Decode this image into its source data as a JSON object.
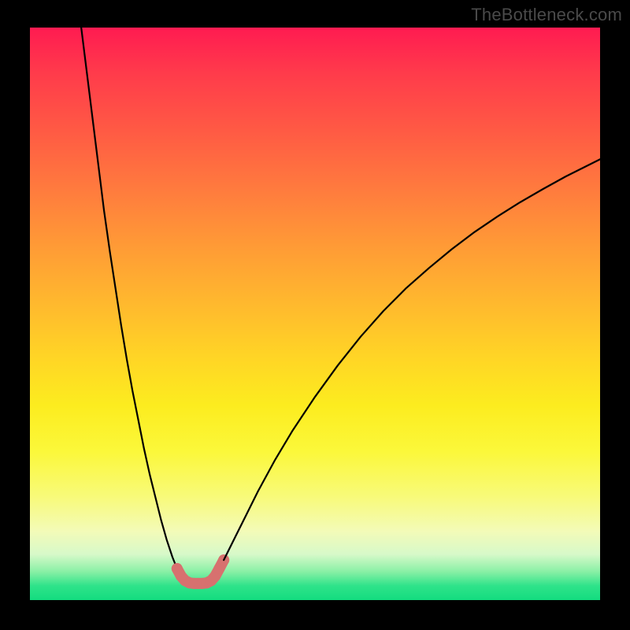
{
  "watermark": "TheBottleneck.com",
  "chart_data": {
    "type": "line",
    "title": "",
    "xlabel": "",
    "ylabel": "",
    "xlim": [
      0,
      100
    ],
    "ylim": [
      0,
      100
    ],
    "grid": false,
    "legend": false,
    "series": [
      {
        "name": "left-branch",
        "stroke": "#000000",
        "strokeWidth": 2.2,
        "x": [
          9,
          10,
          11,
          12,
          13,
          14,
          15,
          16,
          17,
          18,
          19,
          20,
          21,
          22,
          23,
          24,
          25,
          25.8
        ],
        "y": [
          100,
          92,
          84,
          76,
          68,
          61,
          54.5,
          48,
          42,
          36.5,
          31.5,
          26.5,
          22,
          18,
          14,
          10.5,
          7.5,
          5.5
        ]
      },
      {
        "name": "valley-floor",
        "stroke": "#d7716f",
        "strokeWidth": 14,
        "cap": "round",
        "dots": true,
        "x": [
          25.8,
          26.5,
          27.2,
          28.0,
          28.8,
          29.5,
          30.2,
          31.0,
          31.8,
          32.5,
          33.2,
          34.0
        ],
        "y": [
          5.5,
          4.2,
          3.4,
          3.0,
          2.9,
          2.9,
          2.9,
          3.0,
          3.4,
          4.2,
          5.5,
          7.0
        ]
      },
      {
        "name": "right-branch",
        "stroke": "#000000",
        "strokeWidth": 2.2,
        "x": [
          34.0,
          36,
          38,
          40,
          43,
          46,
          50,
          54,
          58,
          62,
          66,
          70,
          74,
          78,
          82,
          86,
          90,
          94,
          98,
          100
        ],
        "y": [
          7.0,
          11,
          15,
          19,
          24.5,
          29.5,
          35.5,
          41,
          46,
          50.5,
          54.5,
          58,
          61.3,
          64.3,
          67,
          69.5,
          71.8,
          74,
          76,
          77
        ]
      }
    ],
    "gradient_bands": [
      {
        "pos": 0.0,
        "color": "#ff1b51"
      },
      {
        "pos": 0.5,
        "color": "#ffb82e"
      },
      {
        "pos": 0.74,
        "color": "#fbf83a"
      },
      {
        "pos": 0.92,
        "color": "#d7f9c9"
      },
      {
        "pos": 1.0,
        "color": "#13dc7f"
      }
    ]
  }
}
